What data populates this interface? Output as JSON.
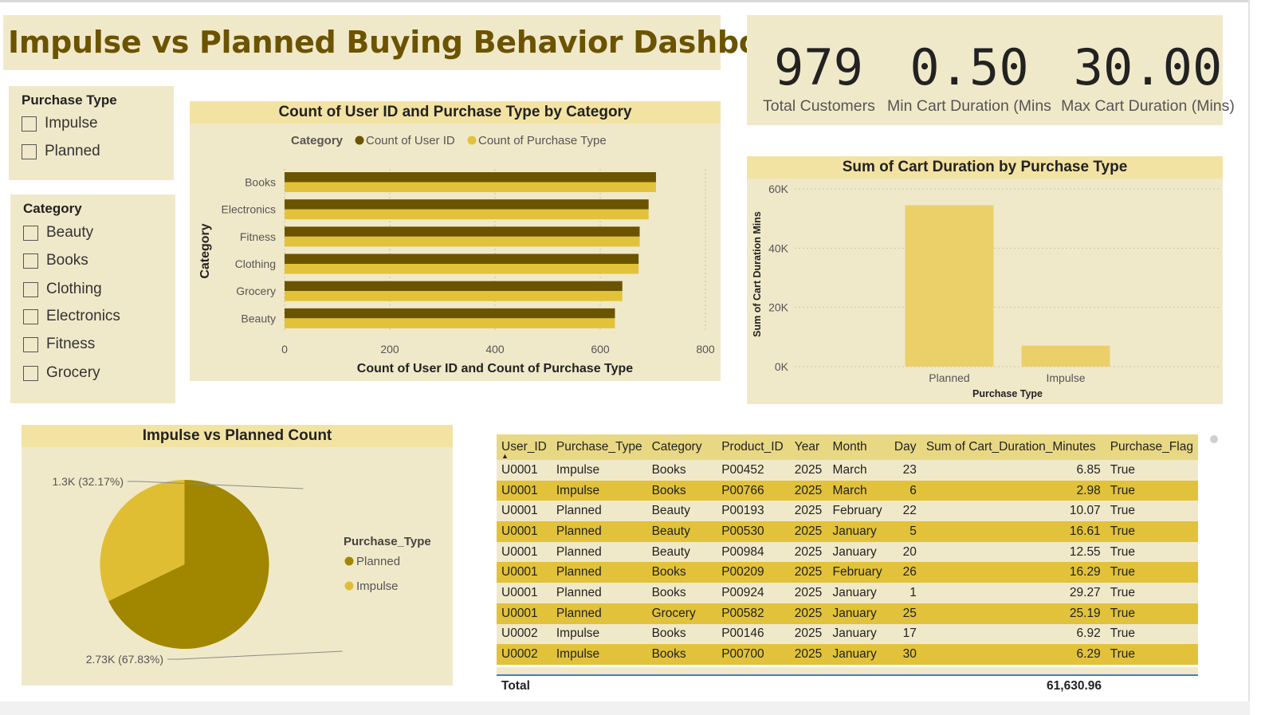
{
  "dashboard": {
    "title": "Impulse vs Planned Buying Behavior Dashboard"
  },
  "slicer_purchase_type": {
    "title": "Purchase Type",
    "items": [
      {
        "label": "Impulse"
      },
      {
        "label": "Planned"
      }
    ]
  },
  "slicer_category": {
    "title": "Category",
    "items": [
      {
        "label": "Beauty"
      },
      {
        "label": "Books"
      },
      {
        "label": "Clothing"
      },
      {
        "label": "Electronics"
      },
      {
        "label": "Fitness"
      },
      {
        "label": "Grocery"
      }
    ]
  },
  "kpis": [
    {
      "value": "979",
      "label": "Total Customers"
    },
    {
      "value": "0.50",
      "label": "Min Cart Duration (Mins"
    },
    {
      "value": "30.00",
      "label": "Max Cart Duration (Mins)"
    }
  ],
  "colors": {
    "dark_gold": "#6b5400",
    "gold": "#e2c23a",
    "pie_dark": "#a18600",
    "pie_light": "#e0be33",
    "panel": "#f0e9c9"
  },
  "chart_data": [
    {
      "type": "bar",
      "orientation": "horizontal",
      "title": "Count of User ID and Purchase Type by Category",
      "legend_title": "Category",
      "legend_position": "top",
      "categories": [
        "Books",
        "Electronics",
        "Fitness",
        "Clothing",
        "Grocery",
        "Beauty"
      ],
      "series": [
        {
          "name": "Count of User ID",
          "values": [
            706,
            692,
            675,
            673,
            642,
            628
          ]
        },
        {
          "name": "Count of Purchase Type",
          "values": [
            706,
            692,
            675,
            673,
            642,
            628
          ]
        }
      ],
      "xlabel": "Count of User ID and Count of Purchase Type",
      "ylabel": "Category",
      "xlim": [
        0,
        800
      ],
      "xticks": [
        "0",
        "200",
        "400",
        "600",
        "800"
      ],
      "grid": true
    },
    {
      "type": "bar",
      "title": "Sum of Cart Duration by Purchase Type",
      "categories": [
        "Planned",
        "Impulse"
      ],
      "values": [
        54500,
        7100
      ],
      "xlabel": "Purchase Type",
      "ylabel": "Sum of Cart Duration Mins",
      "ylim": [
        0,
        60000
      ],
      "yticks": [
        "0K",
        "20K",
        "40K",
        "60K"
      ],
      "grid": true
    },
    {
      "type": "pie",
      "title": "Impulse vs Planned Count",
      "legend_title": "Purchase_Type",
      "legend_position": "right",
      "slices": [
        {
          "name": "Planned",
          "value": 2730,
          "percent": 67.83,
          "label": "2.73K (67.83%)"
        },
        {
          "name": "Impulse",
          "value": 1295,
          "percent": 32.17,
          "label": "1.3K (32.17%)"
        }
      ]
    }
  ],
  "table": {
    "columns": [
      "User_ID",
      "Purchase_Type",
      "Category",
      "Product_ID",
      "Year",
      "Month",
      "Day",
      "Sum of Cart_Duration_Minutes",
      "Purchase_Flag"
    ],
    "rows": [
      [
        "U0001",
        "Impulse",
        "Books",
        "P00452",
        "2025",
        "March",
        "23",
        "6.85",
        "True"
      ],
      [
        "U0001",
        "Impulse",
        "Books",
        "P00766",
        "2025",
        "March",
        "6",
        "2.98",
        "True"
      ],
      [
        "U0001",
        "Planned",
        "Beauty",
        "P00193",
        "2025",
        "February",
        "22",
        "10.07",
        "True"
      ],
      [
        "U0001",
        "Planned",
        "Beauty",
        "P00530",
        "2025",
        "January",
        "5",
        "16.61",
        "True"
      ],
      [
        "U0001",
        "Planned",
        "Beauty",
        "P00984",
        "2025",
        "January",
        "20",
        "12.55",
        "True"
      ],
      [
        "U0001",
        "Planned",
        "Books",
        "P00209",
        "2025",
        "February",
        "26",
        "16.29",
        "True"
      ],
      [
        "U0001",
        "Planned",
        "Books",
        "P00924",
        "2025",
        "January",
        "1",
        "29.27",
        "True"
      ],
      [
        "U0001",
        "Planned",
        "Grocery",
        "P00582",
        "2025",
        "January",
        "25",
        "25.19",
        "True"
      ],
      [
        "U0002",
        "Impulse",
        "Books",
        "P00146",
        "2025",
        "January",
        "17",
        "6.92",
        "True"
      ],
      [
        "U0002",
        "Impulse",
        "Books",
        "P00700",
        "2025",
        "January",
        "30",
        "6.29",
        "True"
      ]
    ],
    "total_label": "Total",
    "total_value": "61,630.96"
  }
}
